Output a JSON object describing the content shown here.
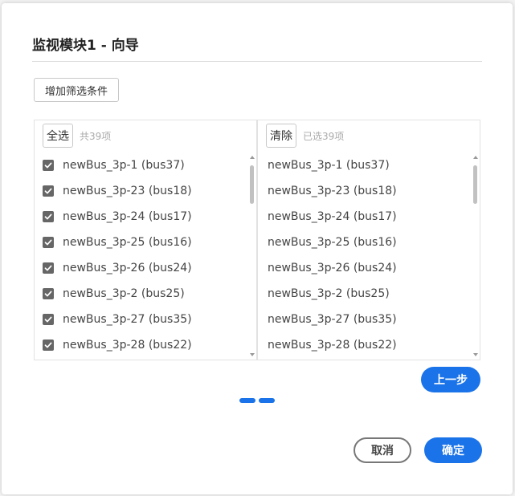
{
  "dialog": {
    "title": "监视模块1 - 向导",
    "add_filter_label": "增加筛选条件"
  },
  "left_panel": {
    "select_all_label": "全选",
    "count_text": "共39项",
    "items": [
      {
        "label": "newBus_3p-1 (bus37)",
        "checked": true
      },
      {
        "label": "newBus_3p-23 (bus18)",
        "checked": true
      },
      {
        "label": "newBus_3p-24 (bus17)",
        "checked": true
      },
      {
        "label": "newBus_3p-25 (bus16)",
        "checked": true
      },
      {
        "label": "newBus_3p-26 (bus24)",
        "checked": true
      },
      {
        "label": "newBus_3p-2 (bus25)",
        "checked": true
      },
      {
        "label": "newBus_3p-27 (bus35)",
        "checked": true
      },
      {
        "label": "newBus_3p-28 (bus22)",
        "checked": true
      }
    ]
  },
  "right_panel": {
    "clear_label": "清除",
    "count_text": "已选39项",
    "items": [
      "newBus_3p-1 (bus37)",
      "newBus_3p-23 (bus18)",
      "newBus_3p-24 (bus17)",
      "newBus_3p-25 (bus16)",
      "newBus_3p-26 (bus24)",
      "newBus_3p-2 (bus25)",
      "newBus_3p-27 (bus35)",
      "newBus_3p-28 (bus22)"
    ]
  },
  "footer": {
    "prev_label": "上一步",
    "cancel_label": "取消",
    "ok_label": "确定",
    "step_count": 2
  },
  "colors": {
    "accent": "#1a73e8",
    "checkbox": "#666666"
  }
}
